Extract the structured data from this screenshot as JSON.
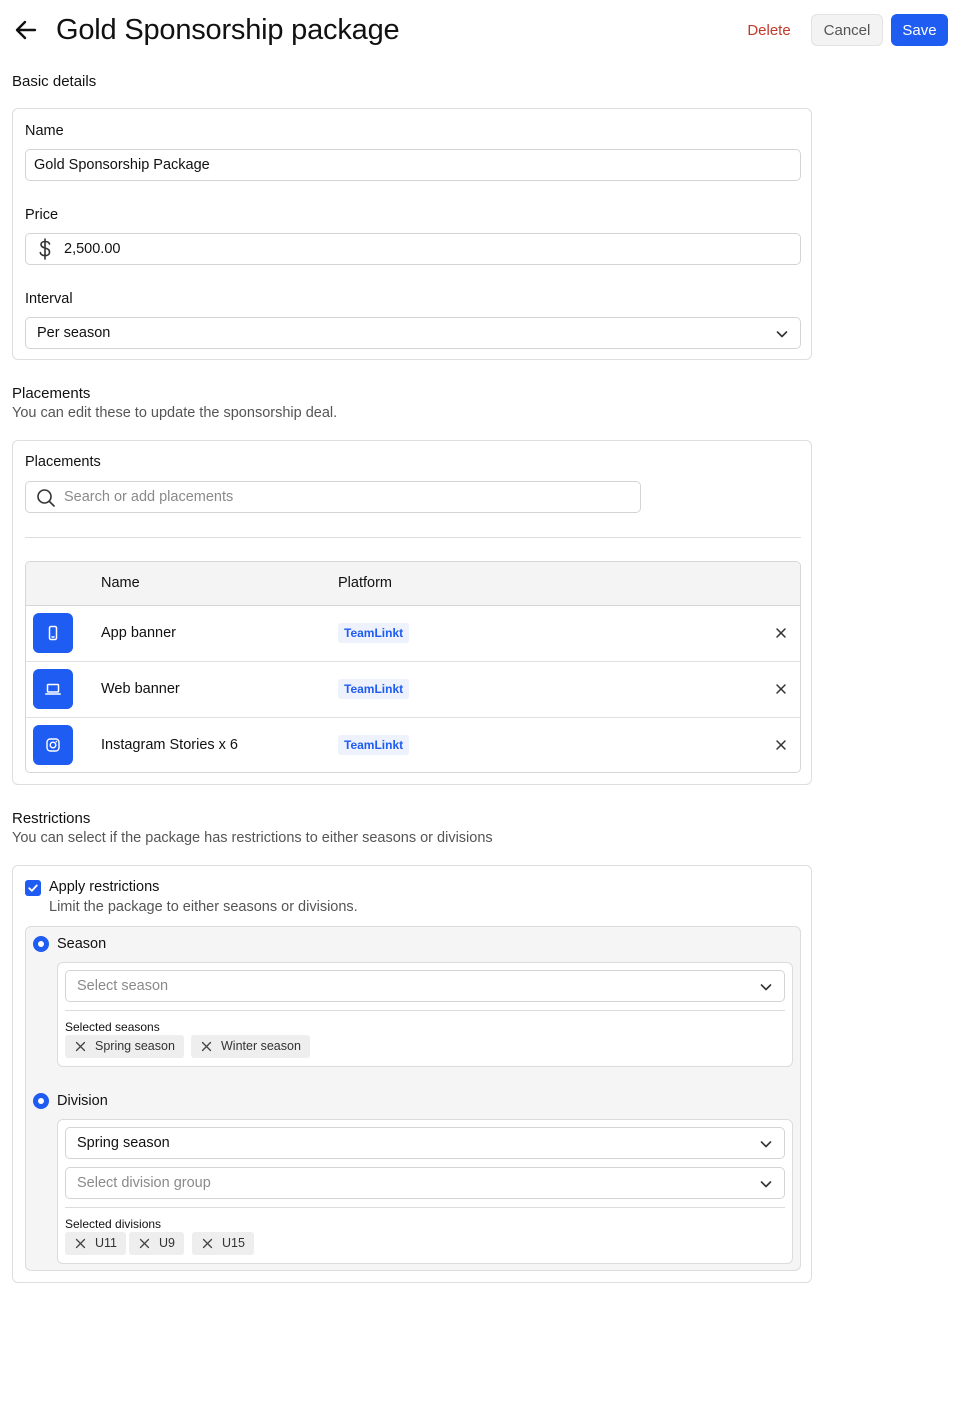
{
  "header": {
    "title": "Gold Sponsorship package",
    "delete_label": "Delete",
    "cancel_label": "Cancel",
    "save_label": "Save"
  },
  "basic_details": {
    "section_title": "Basic details",
    "name_label": "Name",
    "name_value": "Gold Sponsorship Package",
    "price_label": "Price",
    "price_value": "2,500.00",
    "interval_label": "Interval",
    "interval_value": "Per season"
  },
  "placements": {
    "section_title": "Placements",
    "section_desc": "You can edit these to update the sponsorship deal.",
    "card_label": "Placements",
    "search_placeholder": "Search or add placements",
    "columns": [
      "Name",
      "Platform"
    ],
    "rows": [
      {
        "icon": "phone-icon",
        "name": "App banner",
        "platform": "TeamLinkt"
      },
      {
        "icon": "laptop-icon",
        "name": "Web banner",
        "platform": "TeamLinkt"
      },
      {
        "icon": "instagram-icon",
        "name": "Instagram Stories x 6",
        "platform": "TeamLinkt"
      }
    ]
  },
  "restrictions": {
    "section_title": "Restrictions",
    "section_desc": "You can select if the package has restrictions to either seasons or divisions",
    "apply_label": "Apply restrictions",
    "apply_desc": "Limit the package to either seasons or divisions.",
    "apply_checked": true,
    "season": {
      "label": "Season",
      "select_placeholder": "Select season",
      "selected_label": "Selected seasons",
      "chips": [
        "Spring season",
        "Winter season"
      ]
    },
    "division": {
      "label": "Division",
      "season_value": "Spring season",
      "group_placeholder": "Select division group",
      "selected_label": "Selected divisions",
      "chips": [
        "U11",
        "U9",
        "U15"
      ]
    }
  },
  "colors": {
    "accent": "#1f5cf2",
    "danger": "#c0392b",
    "badge_bg": "#eef2fd"
  }
}
